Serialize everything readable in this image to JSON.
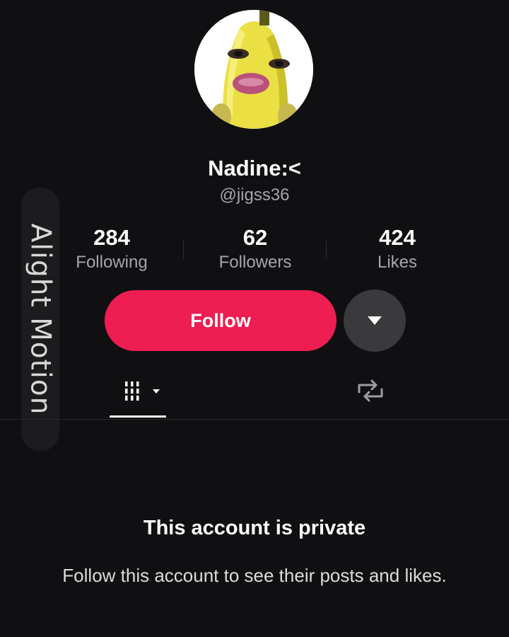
{
  "watermark": {
    "text": "Alight Motion"
  },
  "profile": {
    "avatar_icon": "banana-face-avatar",
    "display_name": "Nadine:<",
    "handle": "@jigss36"
  },
  "stats": [
    {
      "value": "284",
      "label": "Following"
    },
    {
      "value": "62",
      "label": "Followers"
    },
    {
      "value": "424",
      "label": "Likes"
    }
  ],
  "actions": {
    "follow_label": "Follow",
    "more_icon": "caret-down-icon"
  },
  "tabs": [
    {
      "icon": "videos-grid-icon",
      "active": true
    },
    {
      "icon": "repost-icon",
      "active": false
    }
  ],
  "private_notice": {
    "title": "This account is private",
    "subtitle": "Follow this account to see their posts and likes."
  },
  "colors": {
    "background": "#101012",
    "follow_button": "#ee1d52",
    "secondary_text": "#a6a6aa",
    "more_button": "#3a3a3d"
  }
}
